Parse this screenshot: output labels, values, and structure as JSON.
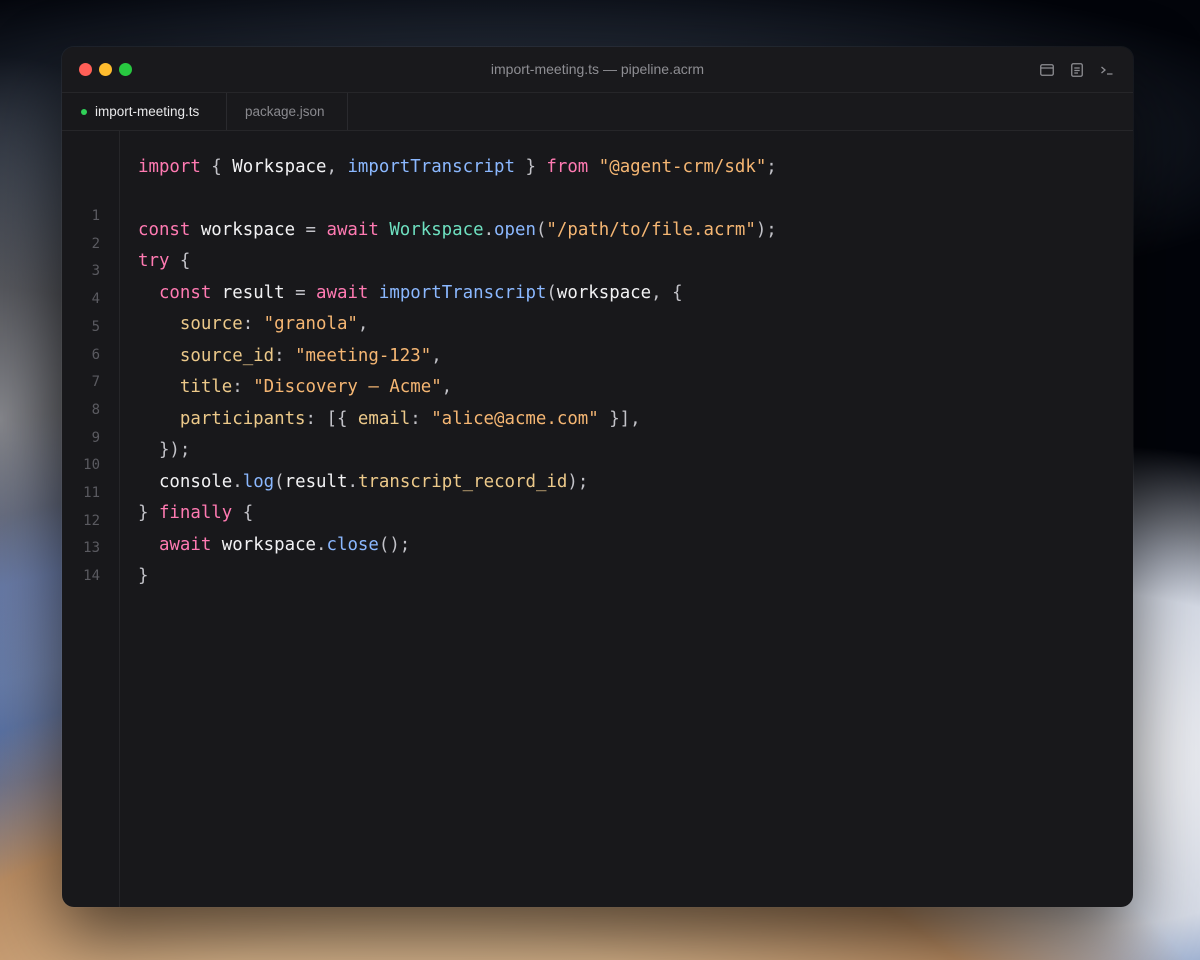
{
  "window": {
    "title": "import-meeting.ts — pipeline.acrm",
    "toolbar_icons": [
      "sidebar-layout-icon",
      "document-outline-icon",
      "terminal-icon"
    ]
  },
  "tabs": [
    {
      "label": "import-meeting.ts",
      "active": true,
      "modified": true
    },
    {
      "label": "package.json",
      "active": false,
      "modified": false
    }
  ],
  "editor": {
    "line_numbers": [
      "1",
      "2",
      "3",
      "4",
      "5",
      "6",
      "7",
      "8",
      "9",
      "10",
      "11",
      "12",
      "13",
      "14"
    ],
    "lines": [
      [
        [
          "kw",
          "import"
        ],
        [
          "pun",
          " { "
        ],
        [
          "id",
          "Workspace"
        ],
        [
          "pun",
          ", "
        ],
        [
          "fn",
          "importTranscript"
        ],
        [
          "pun",
          " } "
        ],
        [
          "kw",
          "from"
        ],
        [
          "pun",
          " "
        ],
        [
          "str",
          "\"@agent-crm/sdk\""
        ],
        [
          "pun",
          ";"
        ]
      ],
      [],
      [
        [
          "kw",
          "const"
        ],
        [
          "id",
          " workspace "
        ],
        [
          "pun",
          "= "
        ],
        [
          "kw",
          "await"
        ],
        [
          "pun",
          " "
        ],
        [
          "cls",
          "Workspace"
        ],
        [
          "pun",
          "."
        ],
        [
          "fn",
          "open"
        ],
        [
          "pun",
          "("
        ],
        [
          "str",
          "\"/path/to/file.acrm\""
        ],
        [
          "pun",
          ");"
        ]
      ],
      [
        [
          "kw",
          "try"
        ],
        [
          "pun",
          " {"
        ]
      ],
      [
        [
          "pun",
          "  "
        ],
        [
          "kw",
          "const"
        ],
        [
          "id",
          " result "
        ],
        [
          "pun",
          "= "
        ],
        [
          "kw",
          "await"
        ],
        [
          "pun",
          " "
        ],
        [
          "fn",
          "importTranscript"
        ],
        [
          "pun",
          "("
        ],
        [
          "id",
          "workspace"
        ],
        [
          "pun",
          ", {"
        ]
      ],
      [
        [
          "pun",
          "    "
        ],
        [
          "prop",
          "source"
        ],
        [
          "pun",
          ": "
        ],
        [
          "str",
          "\"granola\""
        ],
        [
          "pun",
          ","
        ]
      ],
      [
        [
          "pun",
          "    "
        ],
        [
          "prop",
          "source_id"
        ],
        [
          "pun",
          ": "
        ],
        [
          "str",
          "\"meeting-123\""
        ],
        [
          "pun",
          ","
        ]
      ],
      [
        [
          "pun",
          "    "
        ],
        [
          "prop",
          "title"
        ],
        [
          "pun",
          ": "
        ],
        [
          "str",
          "\"Discovery — Acme\""
        ],
        [
          "pun",
          ","
        ]
      ],
      [
        [
          "pun",
          "    "
        ],
        [
          "prop",
          "participants"
        ],
        [
          "pun",
          ": [{ "
        ],
        [
          "prop",
          "email"
        ],
        [
          "pun",
          ": "
        ],
        [
          "str",
          "\"alice@acme.com\""
        ],
        [
          "pun",
          " }],"
        ]
      ],
      [
        [
          "pun",
          "  });"
        ]
      ],
      [
        [
          "pun",
          "  "
        ],
        [
          "id",
          "console"
        ],
        [
          "pun",
          "."
        ],
        [
          "fn",
          "log"
        ],
        [
          "pun",
          "("
        ],
        [
          "id",
          "result"
        ],
        [
          "pun",
          "."
        ],
        [
          "prop",
          "transcript_record_id"
        ],
        [
          "pun",
          ");"
        ]
      ],
      [
        [
          "pun",
          "} "
        ],
        [
          "kw",
          "finally"
        ],
        [
          "pun",
          " {"
        ]
      ],
      [
        [
          "pun",
          "  "
        ],
        [
          "kw",
          "await"
        ],
        [
          "id",
          " workspace"
        ],
        [
          "pun",
          "."
        ],
        [
          "fn",
          "close"
        ],
        [
          "pun",
          "();"
        ]
      ],
      [
        [
          "pun",
          "}"
        ]
      ]
    ]
  },
  "colors": {
    "keyword": "#ff7ab2",
    "function": "#8bb8ff",
    "class": "#6ee0c0",
    "string": "#f5b673",
    "property": "#ecc98a",
    "editor_bg": "#18181b",
    "modified_dot": "#30d158"
  }
}
